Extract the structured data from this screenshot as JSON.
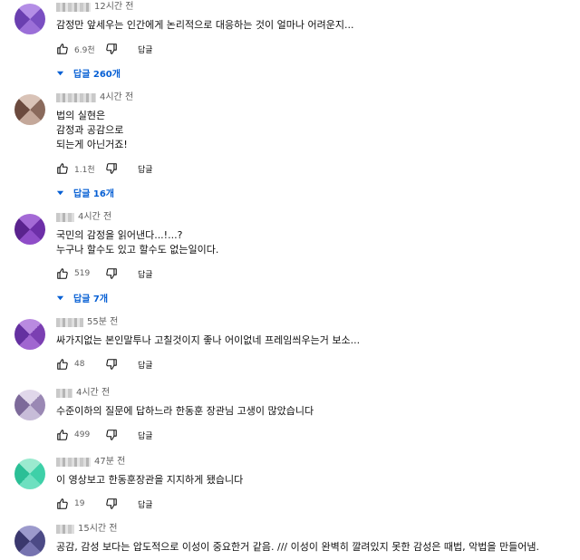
{
  "comments": [
    {
      "time": "12시간 전",
      "text": "감정만 앞세우는 인간에게 논리적으로 대응하는 것이 얼마나 어려운지...",
      "likes": "6.9천",
      "reply_label": "답글",
      "replies": "답글 260개",
      "avatar_colors": [
        "#7a4fc2",
        "#9b6fd8",
        "#6a3fb0",
        "#b48ee6"
      ]
    },
    {
      "time": "4시간 전",
      "text": "법의 실현은\n감정과 공감으로\n되는게 아닌거죠!",
      "likes": "1.1천",
      "reply_label": "답글",
      "replies": "답글 16개",
      "avatar_colors": [
        "#8a6a5c",
        "#c4a89a",
        "#6b4a3e",
        "#d9c3b7"
      ]
    },
    {
      "time": "4시간 전",
      "text": "국민의 감정을 읽어낸다...!...?\n누구나 할수도 있고 할수도 없는일이다.",
      "likes": "519",
      "reply_label": "답글",
      "replies": "답글 7개",
      "avatar_colors": [
        "#6d2fa8",
        "#8f4dc8",
        "#5a238e",
        "#a46ad6"
      ]
    },
    {
      "time": "55분 전",
      "text": "싸가지없는 본인말투나 고칠것이지 좋나 어이없네 프레임씌우는거 보소...",
      "likes": "48",
      "reply_label": "답글",
      "replies": "",
      "avatar_colors": [
        "#7b3fb2",
        "#a066d0",
        "#6430a0",
        "#b98ae0"
      ]
    },
    {
      "time": "4시간 전",
      "text": "수준이하의 질문에 답하느라 한동훈 장관님 고생이 많았습니다",
      "likes": "499",
      "reply_label": "답글",
      "replies": "",
      "avatar_colors": [
        "#9a88b4",
        "#c7bcd8",
        "#7d6a9a",
        "#e0d7ea"
      ]
    },
    {
      "time": "47분 전",
      "text": "이 영상보고 한동훈장관을 지지하게 됐습니다",
      "likes": "19",
      "reply_label": "답글",
      "replies": "",
      "avatar_colors": [
        "#3ed0a8",
        "#6ee0c0",
        "#2bbf96",
        "#9aeacf"
      ]
    },
    {
      "time": "15시간 전",
      "text": "공감, 감성 보다는 압도적으로 이성이 중요한거 같음. /// 이성이 완벽히 깔려있지 못한 감성은 때법, 악법을 만들어냄.",
      "likes": "",
      "reply_label": "",
      "replies": "",
      "avatar_colors": [
        "#4c4a86",
        "#7673b0",
        "#3a386e",
        "#9c9acc"
      ]
    }
  ]
}
